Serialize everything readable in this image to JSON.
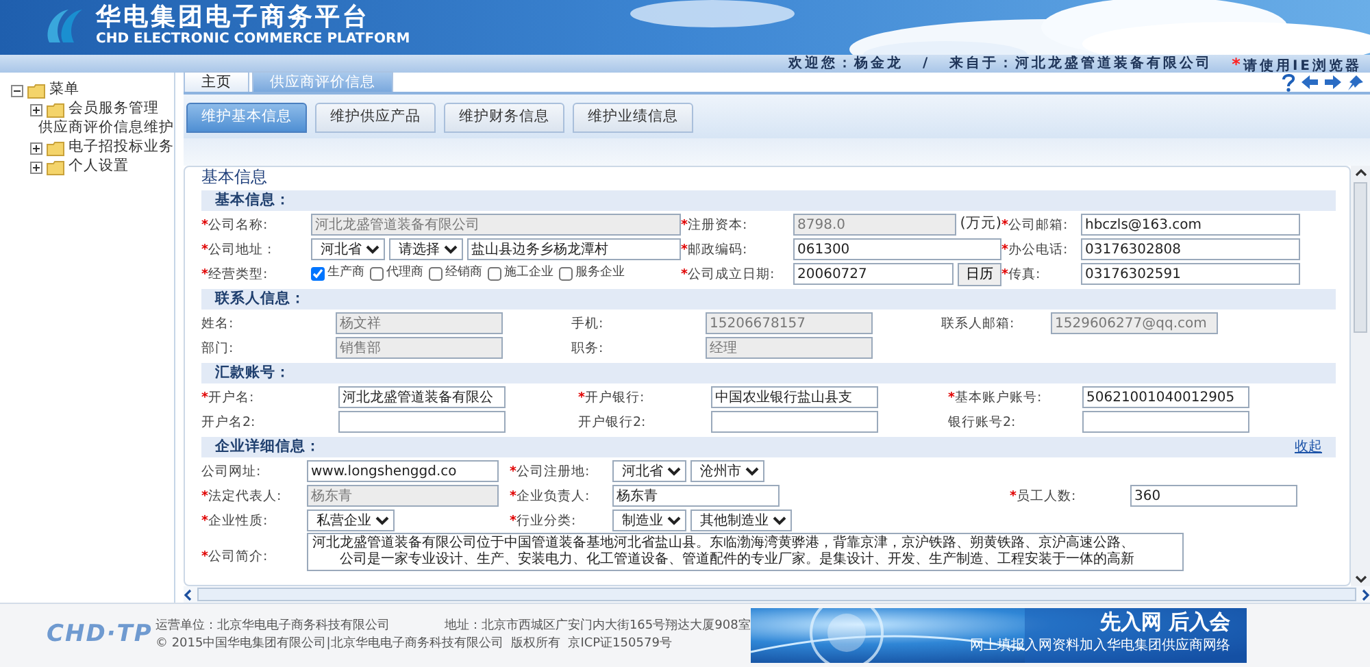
{
  "header": {
    "title": "华电集团电子商务平台",
    "subtitle": "CHD ELECTRONIC COMMERCE PLATFORM",
    "welcome": "欢迎您：杨金龙",
    "separator": "/",
    "from": "来自于：河北龙盛管道装备有限公司",
    "notice_mark": "*",
    "notice": "请使用IE浏览器"
  },
  "sidebar": {
    "items": [
      {
        "label": "菜单",
        "kind": "folder",
        "expanded": true,
        "children": [
          {
            "label": "会员服务管理",
            "kind": "folder",
            "expanded": false
          },
          {
            "label": "供应商评价信息维护",
            "kind": "page"
          },
          {
            "label": "电子招投标业务",
            "kind": "folder",
            "expanded": false
          },
          {
            "label": "个人设置",
            "kind": "folder",
            "expanded": false
          }
        ]
      }
    ]
  },
  "tabs": [
    {
      "label": "主页",
      "selected": false
    },
    {
      "label": "供应商评价信息",
      "selected": true
    }
  ],
  "subtabs": [
    {
      "label": "维护基本信息",
      "selected": true
    },
    {
      "label": "维护供应产品",
      "selected": false
    },
    {
      "label": "维护财务信息",
      "selected": false
    },
    {
      "label": "维护业绩信息",
      "selected": false
    }
  ],
  "panel": {
    "title": "基本信息",
    "sections": [
      {
        "title": "基本信息：",
        "rows": [
          [
            {
              "kind": "label",
              "text": "公司名称:",
              "required": true
            },
            {
              "kind": "input",
              "value": "河北龙盛管道装备有限公司",
              "readonly": true
            },
            {
              "kind": "label",
              "text": "注册资本:",
              "required": true
            },
            {
              "kind": "group",
              "items": [
                {
                  "kind": "input",
                  "value": "8798.0",
                  "readonly": true
                },
                {
                  "kind": "suffix",
                  "text": "(万元)"
                }
              ]
            },
            {
              "kind": "label",
              "text": "公司邮箱:",
              "required": true
            },
            {
              "kind": "input",
              "value": "hbczls@163.com",
              "readonly": false
            }
          ],
          [
            {
              "kind": "label",
              "text": "公司地址 :",
              "required": true
            },
            {
              "kind": "group",
              "items": [
                {
                  "kind": "select",
                  "value": "河北省"
                },
                {
                  "kind": "select",
                  "value": "请选择"
                },
                {
                  "kind": "input",
                  "value": "盐山县边务乡杨龙潭村",
                  "readonly": false
                }
              ]
            },
            {
              "kind": "label",
              "text": "邮政编码:",
              "required": true
            },
            {
              "kind": "input",
              "value": "061300",
              "readonly": false
            },
            {
              "kind": "label",
              "text": "办公电话:",
              "required": true
            },
            {
              "kind": "input",
              "value": "03176302808",
              "readonly": false
            }
          ],
          [
            {
              "kind": "label",
              "text": "经营类型:",
              "required": true
            },
            {
              "kind": "checks",
              "options": [
                {
                  "label": "生产商",
                  "checked": true
                },
                {
                  "label": "代理商",
                  "checked": false
                },
                {
                  "label": "经销商",
                  "checked": false
                },
                {
                  "label": "施工企业",
                  "checked": false
                },
                {
                  "label": "服务企业",
                  "checked": false
                }
              ]
            },
            {
              "kind": "label",
              "text": "公司成立日期:",
              "required": true
            },
            {
              "kind": "group",
              "items": [
                {
                  "kind": "input",
                  "value": "20060727",
                  "readonly": false
                },
                {
                  "kind": "button",
                  "text": "日历"
                }
              ]
            },
            {
              "kind": "label",
              "text": "传真:",
              "required": true
            },
            {
              "kind": "input",
              "value": "03176302591",
              "readonly": false
            }
          ]
        ]
      },
      {
        "title": "联系人信息：",
        "rows": [
          [
            {
              "kind": "label",
              "text": "姓名:",
              "required": false
            },
            {
              "kind": "input",
              "value": "杨文祥",
              "readonly": true
            },
            {
              "kind": "label",
              "text": "手机:",
              "required": false
            },
            {
              "kind": "input",
              "value": "15206678157",
              "readonly": true
            },
            {
              "kind": "label",
              "text": "联系人邮箱:",
              "required": false
            },
            {
              "kind": "input",
              "value": "1529606277@qq.com",
              "readonly": true
            }
          ],
          [
            {
              "kind": "label",
              "text": "部门:",
              "required": false
            },
            {
              "kind": "input",
              "value": "销售部",
              "readonly": true
            },
            {
              "kind": "label",
              "text": "职务:",
              "required": false
            },
            {
              "kind": "input",
              "value": "经理",
              "readonly": true
            }
          ]
        ]
      },
      {
        "title": "汇款账号：",
        "rows": [
          [
            {
              "kind": "label",
              "text": "开户名:",
              "required": true
            },
            {
              "kind": "input",
              "value": "河北龙盛管道装备有限公",
              "readonly": false
            },
            {
              "kind": "label",
              "text": "开户银行:",
              "required": true
            },
            {
              "kind": "input",
              "value": "中国农业银行盐山县支",
              "readonly": false
            },
            {
              "kind": "label",
              "text": "基本账户账号:",
              "required": true
            },
            {
              "kind": "input",
              "value": "50621001040012905",
              "readonly": false
            }
          ],
          [
            {
              "kind": "label",
              "text": "开户名2:",
              "required": false
            },
            {
              "kind": "input",
              "readonly": false
            },
            {
              "kind": "label",
              "text": "开户银行2:",
              "required": false
            },
            {
              "kind": "input",
              "readonly": false
            },
            {
              "kind": "label",
              "text": "银行账号2:",
              "required": false
            },
            {
              "kind": "input",
              "readonly": false
            }
          ]
        ]
      },
      {
        "title": "企业详细信息：",
        "link": "收起",
        "rows": [
          [
            {
              "kind": "label",
              "text": "公司网址:",
              "required": false
            },
            {
              "kind": "input",
              "value": "www.longshenggd.co",
              "readonly": false
            },
            {
              "kind": "label",
              "text": "公司注册地:",
              "required": true
            },
            {
              "kind": "group",
              "items": [
                {
                  "kind": "select",
                  "value": "河北省"
                },
                {
                  "kind": "select",
                  "value": "沧州市"
                }
              ]
            }
          ],
          [
            {
              "kind": "label",
              "text": "法定代表人:",
              "required": true
            },
            {
              "kind": "input",
              "value": "杨东青",
              "readonly": true
            },
            {
              "kind": "label",
              "text": "企业负责人:",
              "required": true
            },
            {
              "kind": "input",
              "value": "杨东青",
              "readonly": false
            },
            {
              "kind": "label",
              "text": "员工人数:",
              "required": true
            },
            {
              "kind": "input",
              "value": "360",
              "readonly": false
            }
          ],
          [
            {
              "kind": "label",
              "text": "企业性质:",
              "required": true
            },
            {
              "kind": "select",
              "value": "私营企业"
            },
            {
              "kind": "label",
              "text": "行业分类:",
              "required": true
            },
            {
              "kind": "group",
              "items": [
                {
                  "kind": "select",
                  "value": "制造业"
                },
                {
                  "kind": "select",
                  "value": "其他制造业"
                }
              ]
            }
          ],
          [
            {
              "kind": "label",
              "text": "公司简介:",
              "required": true
            },
            {
              "kind": "textarea",
              "lines": [
                "河北龙盛管道装备有限公司位于中国管道装备基地河北省盐山县。东临渤海湾黄骅港，背靠京津，京沪铁路、朔黄铁路、京沪高速公路、",
                "　　公司是一家专业设计、生产、安装电力、化工管道设备、管道配件的专业厂家。是集设计、开发、生产制造、工程安装于一体的高新"
              ]
            }
          ]
        ]
      }
    ]
  },
  "footer": {
    "logo": "CHD·TP",
    "operator": "运营单位：北京华电电子商务科技有限公司",
    "address": "地址：北京市西城区广安门内大街165号翔达大厦908室",
    "copyright": "© 2015中国华电集团有限公司|北京华电电子商务科技有限公司  版权所有  京ICP证150579号",
    "banner_title": "先入网 后入会",
    "banner_text": "网上填报入网资料加入华电集团供应商网络"
  }
}
